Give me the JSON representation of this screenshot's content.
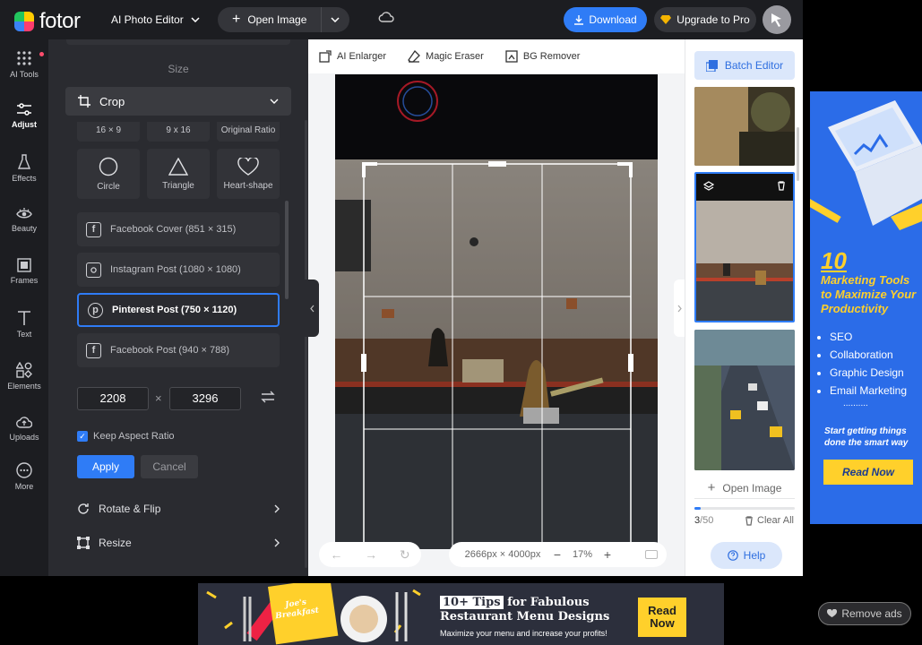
{
  "header": {
    "logo_text": "fotor",
    "ai_editor_label": "AI Photo Editor",
    "open_image_label": "Open Image",
    "download_label": "Download",
    "upgrade_label": "Upgrade to Pro"
  },
  "rail": {
    "items": [
      {
        "label": "AI Tools",
        "icon": "grid-icon"
      },
      {
        "label": "Adjust",
        "icon": "sliders-icon",
        "active": true
      },
      {
        "label": "Effects",
        "icon": "flask-icon"
      },
      {
        "label": "Beauty",
        "icon": "eye-icon"
      },
      {
        "label": "Frames",
        "icon": "frame-icon"
      },
      {
        "label": "Text",
        "icon": "text-icon"
      },
      {
        "label": "Elements",
        "icon": "shapes-icon"
      },
      {
        "label": "Uploads",
        "icon": "upload-icon"
      },
      {
        "label": "More",
        "icon": "more-icon"
      }
    ]
  },
  "panel": {
    "size_label": "Size",
    "crop_label": "Crop",
    "ratios": [
      "16 × 9",
      "9 x 16",
      "Original Ratio"
    ],
    "shapes": [
      "Circle",
      "Triangle",
      "Heart-shape"
    ],
    "presets": [
      {
        "label": "Facebook Cover (851 × 315)",
        "icon": "facebook-icon"
      },
      {
        "label": "Instagram Post (1080 × 1080)",
        "icon": "instagram-icon"
      },
      {
        "label": "Pinterest Post (750 × 1120)",
        "icon": "pinterest-icon",
        "selected": true
      },
      {
        "label": "Facebook Post (940 × 788)",
        "icon": "facebook-icon"
      }
    ],
    "width_value": "2208",
    "height_value": "3296",
    "times_symbol": "×",
    "keep_aspect_label": "Keep Aspect Ratio",
    "keep_aspect_checked": true,
    "apply_label": "Apply",
    "cancel_label": "Cancel",
    "rotate_label": "Rotate & Flip",
    "resize_label": "Resize"
  },
  "tools": {
    "ai_enlarger": "AI Enlarger",
    "magic_eraser": "Magic Eraser",
    "bg_remover": "BG Remover"
  },
  "canvas": {
    "resolution": "2666px × 4000px",
    "zoom_minus": "−",
    "zoom_percent": "17%",
    "zoom_plus": "+"
  },
  "batch": {
    "batch_editor_label": "Batch Editor",
    "open_image_label": "Open Image",
    "count_current": "3",
    "count_total": "/50",
    "progress_fraction": 0.06,
    "clear_all_label": "Clear All",
    "help_label": "Help"
  },
  "side_ad": {
    "number": "10",
    "headline": "Marketing Tools to Maximize Your Productivity",
    "items": [
      "SEO",
      "Collaboration",
      "Graphic Design",
      "Email Marketing"
    ],
    "dots": "..........",
    "tagline": "Start getting things done the smart way",
    "cta": "Read Now"
  },
  "bottom_ad": {
    "badge": "10+ Tips",
    "title_rest": "for Fabulous",
    "title_line2": "Restaurant Menu Designs",
    "subtitle": "Maximize your menu and increase your profits!",
    "cta_line1": "Read",
    "cta_line2": "Now",
    "menu_card_text": "Joe's Breakfast"
  },
  "remove_ads_label": "Remove ads",
  "colors": {
    "accent": "#2f7cf6",
    "panel_bg": "#2a2b30",
    "ad_blue": "#2b6ce8",
    "ad_yellow": "#ffd02b"
  }
}
